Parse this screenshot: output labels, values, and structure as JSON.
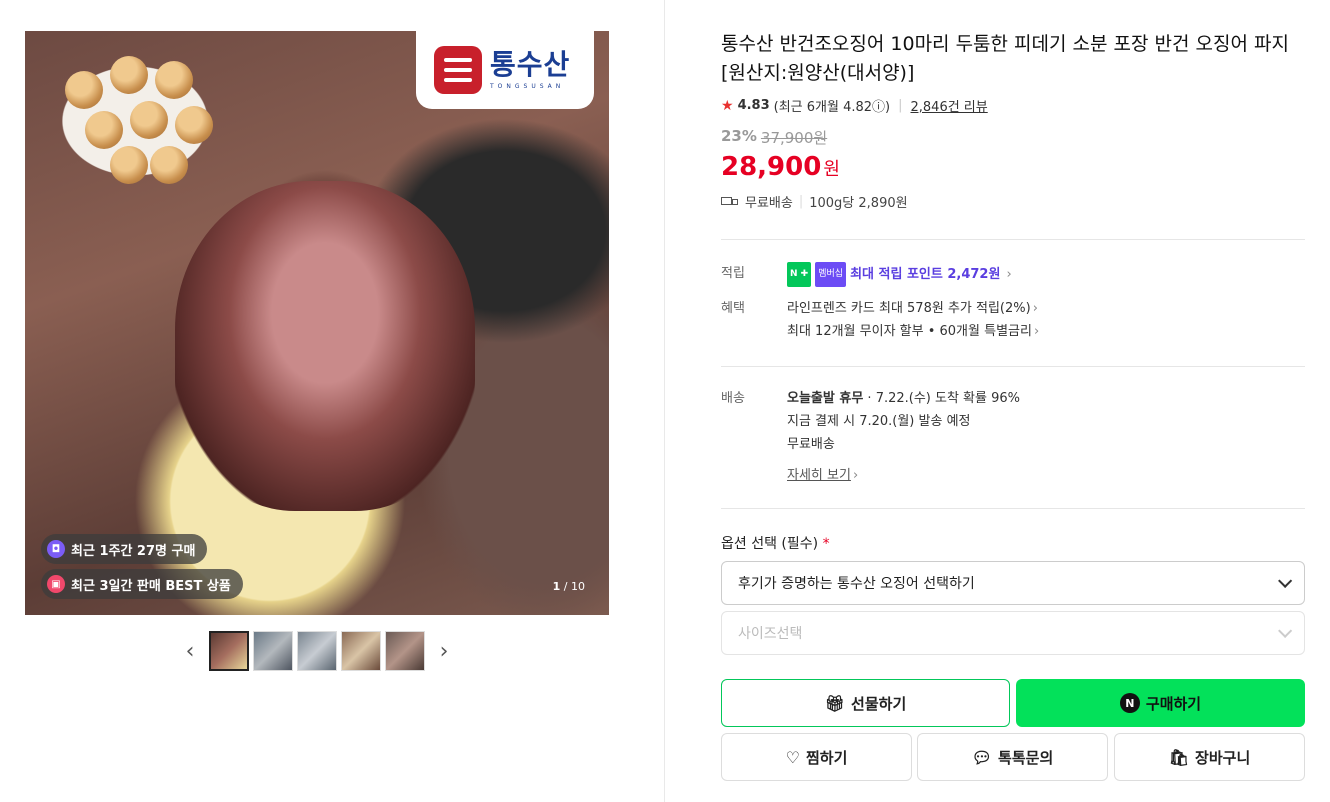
{
  "gallery": {
    "brand_kr": "통수산",
    "brand_en": "TONGSUSAN",
    "badge_recent_purchase": "최근 1주간 27명 구매",
    "badge_best": "최근 3일간 판매 BEST 상품",
    "counter_current": "1",
    "counter_total": "/ 10",
    "prev_arrow": "‹",
    "next_arrow": "›"
  },
  "product": {
    "title": "통수산 반건조오징어 10마리 두툼한 피데기 소분 포장 반건 오징어 파지 [원산지:원양산(대서양)]",
    "rating": "4.83",
    "rating_recent": "(최근 6개월 4.82ⓘ)",
    "review_count": "2,846건 리뷰",
    "discount_pct": "23%",
    "original_price": "37,900원",
    "price": "28,900",
    "price_unit": "원",
    "shipping_free": "무료배송",
    "unit_price": "100g당 2,890원"
  },
  "benefits": {
    "points_label": "적립",
    "npay_badge": "N ✚",
    "membership_badge": "멤버십",
    "points_text": "최대 적립 포인트 2,472원",
    "benefit_label": "혜택",
    "card_benefit": "라인프렌즈 카드 최대 578원 추가 적립(2%)",
    "installment": "최대 12개월 무이자 할부 • 60개월 특별금리"
  },
  "delivery": {
    "label": "배송",
    "today_status": "오늘출발 휴무",
    "arrival": " · 7.22.(수) 도착 확률 96%",
    "dispatch": "지금 결제 시 7.20.(월) 발송 예정",
    "fee": "무료배송",
    "details_link": "자세히 보기"
  },
  "options": {
    "label": "옵션 선택 (필수)",
    "required_mark": "*",
    "select1": "후기가 증명하는 통수산 오징어 선택하기",
    "select2_placeholder": "사이즈선택"
  },
  "actions": {
    "gift": "선물하기",
    "buy": "구매하기",
    "wish": "찜하기",
    "talk": "톡톡문의",
    "cart": "장바구니"
  },
  "colors": {
    "price_red": "#e60023",
    "naver_green": "#03c75a",
    "brand_blue": "#1b3e93",
    "brand_red": "#c8202b"
  }
}
